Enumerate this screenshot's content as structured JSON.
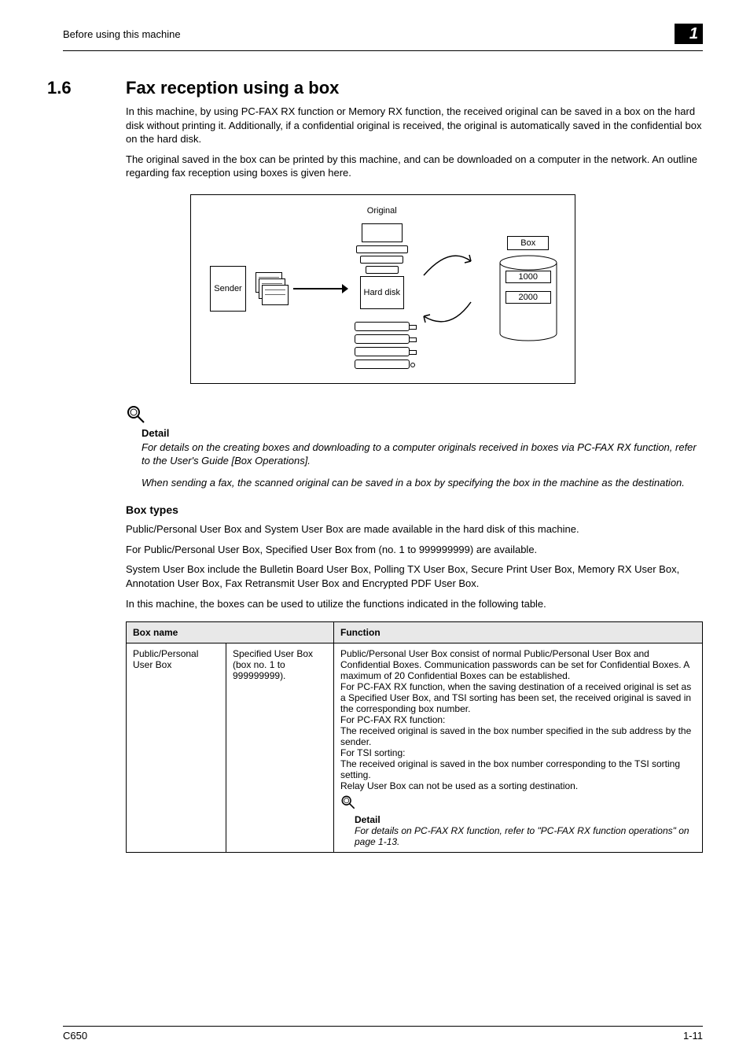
{
  "header": {
    "running_head": "Before using this machine",
    "chapter_number": "1"
  },
  "section": {
    "number": "1.6",
    "title": "Fax reception using a box"
  },
  "intro": {
    "p1": "In this machine, by using PC-FAX RX function or Memory RX function, the received original can be saved in a box on the hard disk without printing it. Additionally, if a confidential original is received, the original is automatically saved in the confidential box on the hard disk.",
    "p2": "The original saved in the box can be printed by this machine, and can be downloaded on a computer in the network. An outline regarding fax reception using boxes is given here."
  },
  "diagram": {
    "sender": "Sender",
    "original": "Original",
    "hard_disk": "Hard disk",
    "box": "Box",
    "box_ids": [
      "1000",
      "2000"
    ]
  },
  "detail": {
    "heading": "Detail",
    "p1": "For details on the creating boxes and downloading to a computer originals received in boxes via PC-FAX RX function, refer to the User's Guide [Box Operations].",
    "p2": "When sending a fax, the scanned original can be saved in a box by specifying the box in the machine as the destination."
  },
  "box_types": {
    "heading": "Box types",
    "p1": "Public/Personal User Box and System User Box are made available in the hard disk of this machine.",
    "p2": "For Public/Personal User Box, Specified User Box from (no. 1 to 999999999) are available.",
    "p3": "System User Box include the Bulletin Board User Box, Polling TX User Box, Secure Print User Box, Memory RX User Box, Annotation User Box, Fax Retransmit User Box and Encrypted PDF User Box.",
    "p4": "In this machine, the boxes can be used to utilize the functions indicated in the following table."
  },
  "table": {
    "headers": {
      "col1": "Box name",
      "col2": "Function"
    },
    "row1": {
      "name": "Public/Personal User Box",
      "sub": "Specified User Box (box no. 1 to 999999999).",
      "func_lines": [
        "Public/Personal User Box consist of normal Public/Personal User Box and Confidential Boxes. Communication passwords can be set for Confidential Boxes. A maximum of 20 Confidential Boxes can be established.",
        "For PC-FAX RX function, when the saving destination of a received original is set as a Specified User Box, and TSI sorting has been set, the received original is saved in the corresponding box number.",
        "For PC-FAX RX function:",
        "The received original is saved in the box number specified in the sub address by the sender.",
        "For TSI sorting:",
        "The received original is saved in the box number corresponding to the TSI sorting setting.",
        "Relay User Box can not be used as a sorting destination."
      ],
      "detail_head": "Detail",
      "detail_text": "For details on PC-FAX RX function, refer to \"PC-FAX RX function operations\" on page 1-13."
    }
  },
  "footer": {
    "left": "C650",
    "right": "1-11"
  }
}
